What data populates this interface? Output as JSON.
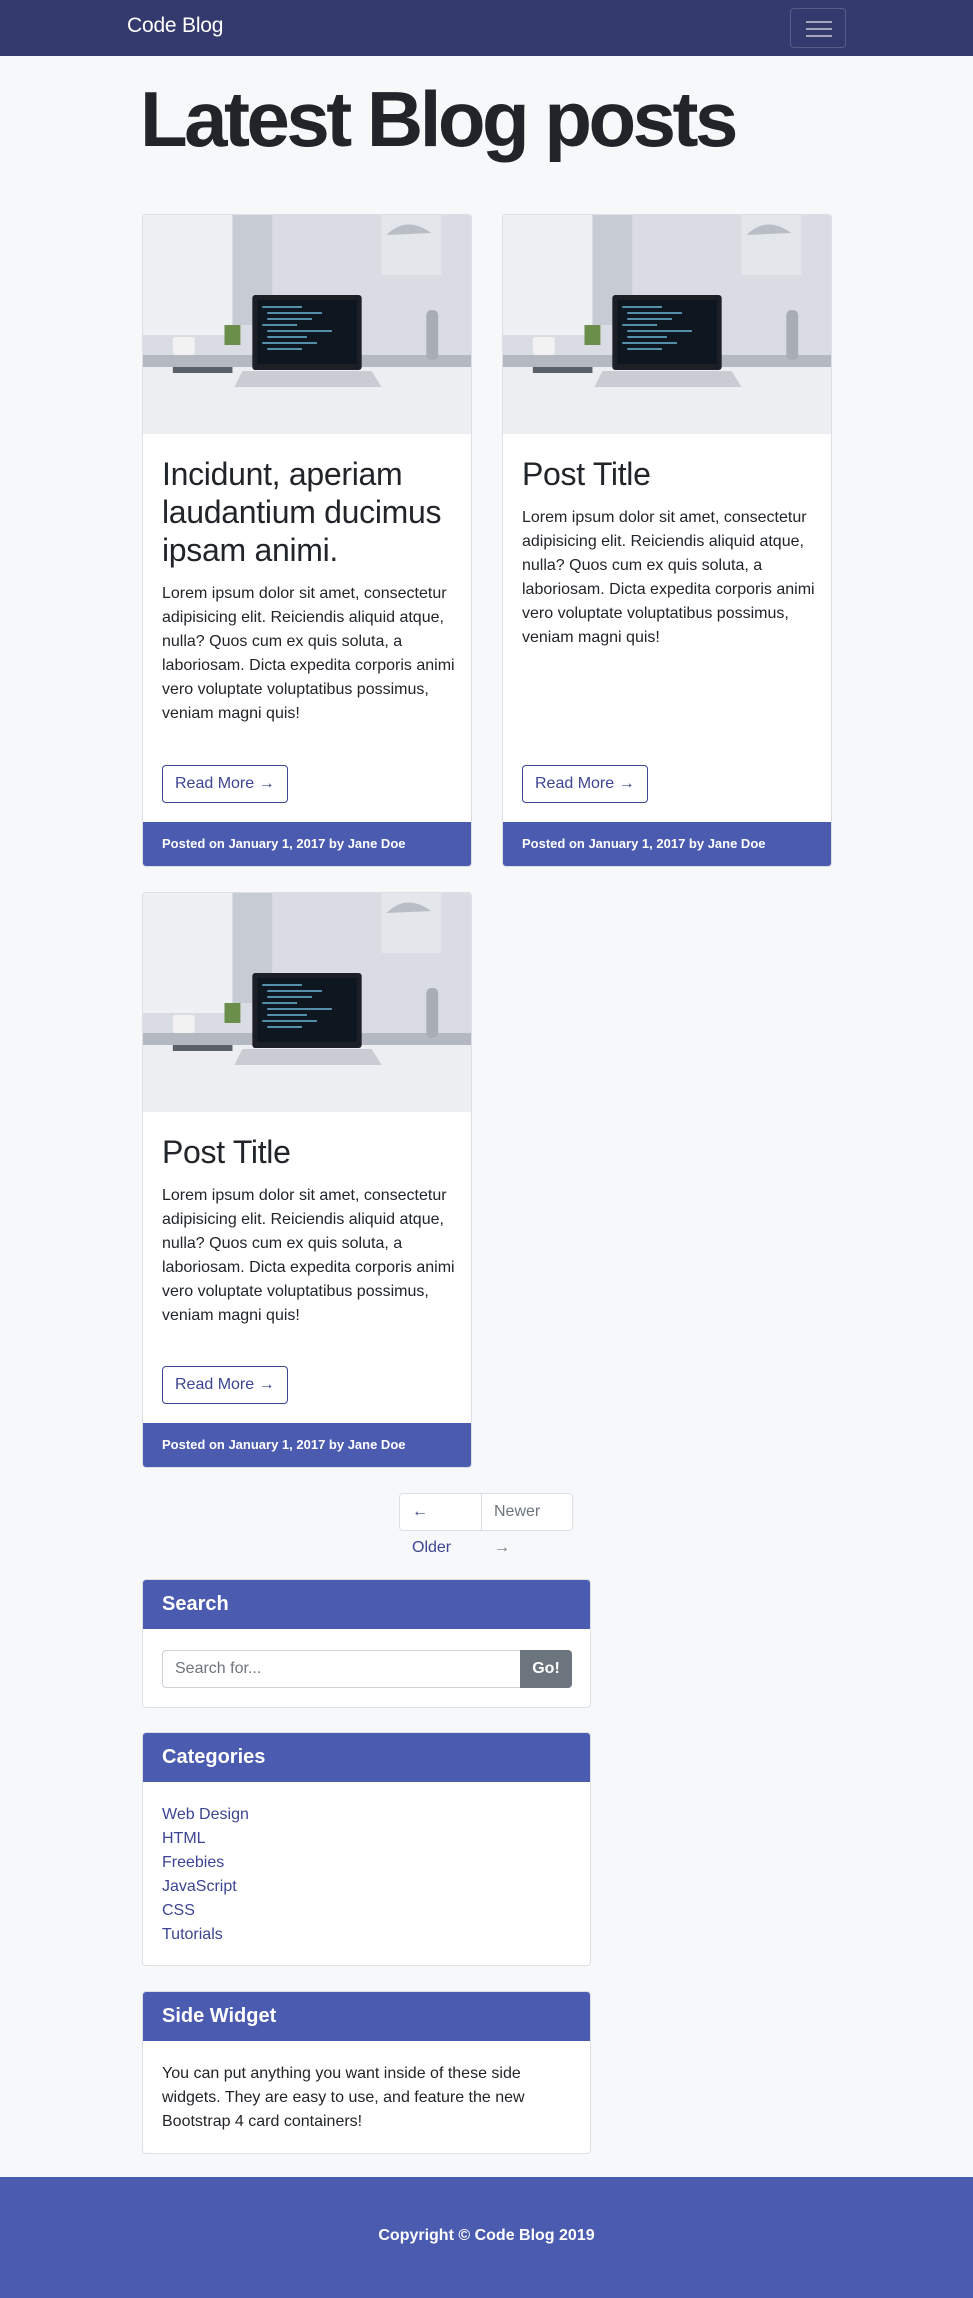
{
  "navbar": {
    "brand": "Code Blog"
  },
  "page": {
    "title": "Latest Blog posts"
  },
  "posts": [
    {
      "title": "Incidunt, aperiam laudantium ducimus ipsam animi.",
      "text": "Lorem ipsum dolor sit amet, consectetur adipisicing elit. Reiciendis aliquid atque, nulla? Quos cum ex quis soluta, a laboriosam. Dicta expedita corporis animi vero voluptate voluptatibus possimus, veniam magni quis!",
      "button": "Read More →",
      "footer": "Posted on January 1, 2017 by Jane Doe"
    },
    {
      "title": "Post Title",
      "text": "Lorem ipsum dolor sit amet, consectetur adipisicing elit. Reiciendis aliquid atque, nulla? Quos cum ex quis soluta, a laboriosam. Dicta expedita corporis animi vero voluptate voluptatibus possimus, veniam magni quis!",
      "button": "Read More →",
      "footer": "Posted on January 1, 2017 by Jane Doe"
    },
    {
      "title": "Post Title",
      "text": "Lorem ipsum dolor sit amet, consectetur adipisicing elit. Reiciendis aliquid atque, nulla? Quos cum ex quis soluta, a laboriosam. Dicta expedita corporis animi vero voluptate voluptatibus possimus, veniam magni quis!",
      "button": "Read More →",
      "footer": "Posted on January 1, 2017 by Jane Doe"
    }
  ],
  "pagination": {
    "older": "← Older",
    "newer": "Newer →"
  },
  "search": {
    "title": "Search",
    "placeholder": "Search for...",
    "button": "Go!"
  },
  "categories": {
    "title": "Categories",
    "items": [
      "Web Design",
      "HTML",
      "Freebies",
      "JavaScript",
      "CSS",
      "Tutorials"
    ]
  },
  "side_widget": {
    "title": "Side Widget",
    "text": "You can put anything you want inside of these side widgets. They are easy to use, and feature the new Bootstrap 4 card containers!"
  },
  "footer": {
    "copyright": "Copyright © Code Blog 2019"
  },
  "colors": {
    "navbar": "#343a6e",
    "accent": "#4a5bb0",
    "link": "#3c4592",
    "background": "#f7f8fa"
  }
}
